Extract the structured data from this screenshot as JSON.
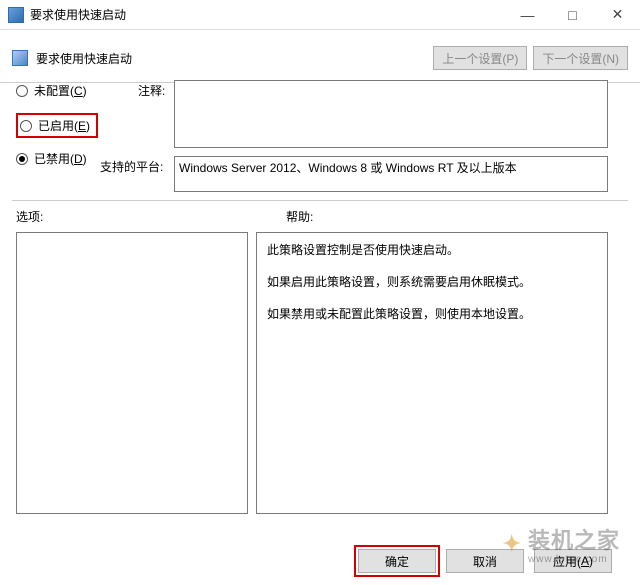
{
  "titlebar": {
    "title": "要求使用快速启动"
  },
  "subbar": {
    "title": "要求使用快速启动",
    "prev": "上一个设置(P)",
    "next": "下一个设置(N)"
  },
  "radios": {
    "not_configured": "未配置(C)",
    "enabled": "已启用(E)",
    "disabled": "已禁用(D)",
    "selected": "disabled",
    "highlighted": "enabled"
  },
  "labels": {
    "comment": "注释:",
    "platform": "支持的平台:",
    "options": "选项:",
    "help": "帮助:"
  },
  "fields": {
    "comment": "",
    "platform": "Windows Server 2012、Windows 8 或 Windows RT 及以上版本"
  },
  "help": {
    "p1": "此策略设置控制是否使用快速启动。",
    "p2": "如果启用此策略设置，则系统需要启用休眠模式。",
    "p3": "如果禁用或未配置此策略设置，则使用本地设置。"
  },
  "footer": {
    "ok": "确定",
    "cancel": "取消",
    "apply": "应用(A)"
  },
  "watermark": {
    "brand": "装机之家",
    "url": "www.lotpc.com"
  }
}
